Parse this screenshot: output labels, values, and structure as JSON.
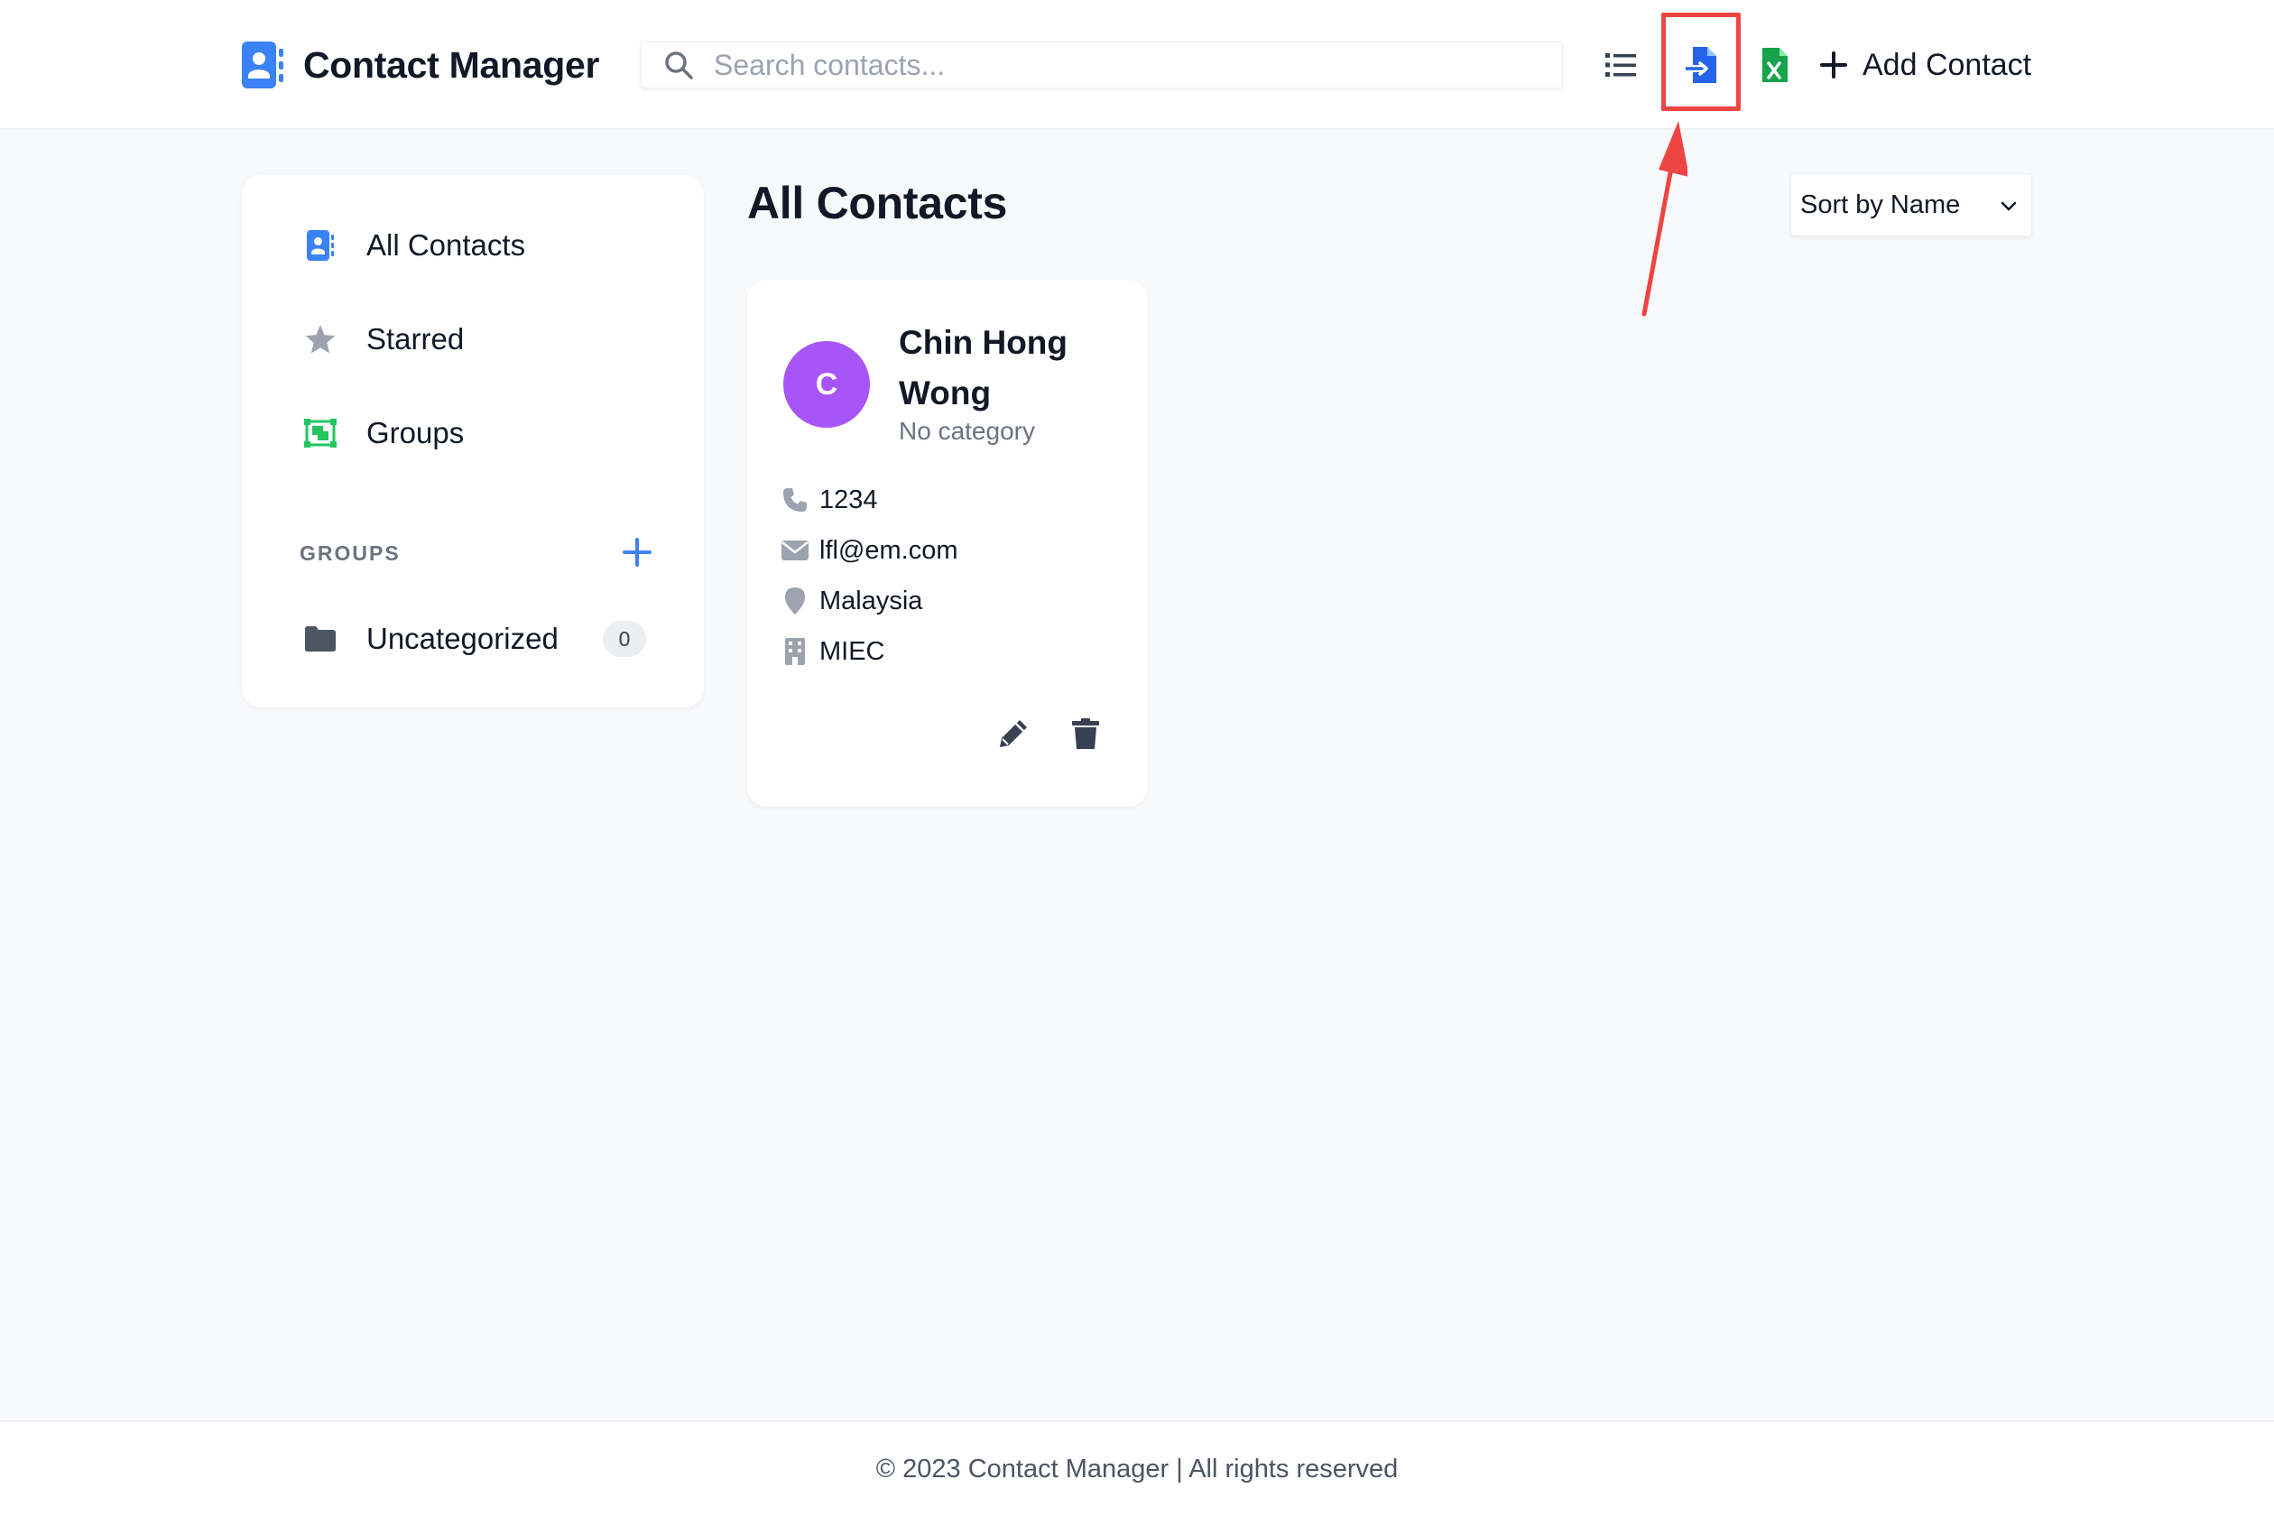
{
  "header": {
    "app_title": "Contact Manager",
    "search_placeholder": "Search contacts...",
    "add_contact_label": "Add Contact",
    "icons": {
      "brand": "contact-book-icon",
      "search": "search-icon",
      "list_view": "list-icon",
      "import": "file-import-icon",
      "export_excel": "file-excel-icon",
      "add": "plus-icon"
    },
    "colors": {
      "brand": "#3b82f6",
      "import": "#2563eb",
      "excel": "#16a34a",
      "highlight": "#ef4444"
    }
  },
  "sidebar": {
    "nav": [
      {
        "label": "All Contacts",
        "icon": "contact-book-icon"
      },
      {
        "label": "Starred",
        "icon": "star-icon"
      },
      {
        "label": "Groups",
        "icon": "object-group-icon"
      }
    ],
    "groups_heading": "GROUPS",
    "groups": [
      {
        "label": "Uncategorized",
        "count": "0",
        "icon": "folder-icon"
      }
    ]
  },
  "main": {
    "title": "All Contacts",
    "sort": {
      "selected": "Sort by Name"
    },
    "contacts": [
      {
        "initial": "C",
        "name": "Chin Hong Wong",
        "category": "No category",
        "phone": "1234",
        "email": "lfl@em.com",
        "location": "Malaysia",
        "company": "MIEC",
        "avatar_color": "#a855f7"
      }
    ]
  },
  "footer": {
    "text": "© 2023 Contact Manager | All rights reserved"
  }
}
